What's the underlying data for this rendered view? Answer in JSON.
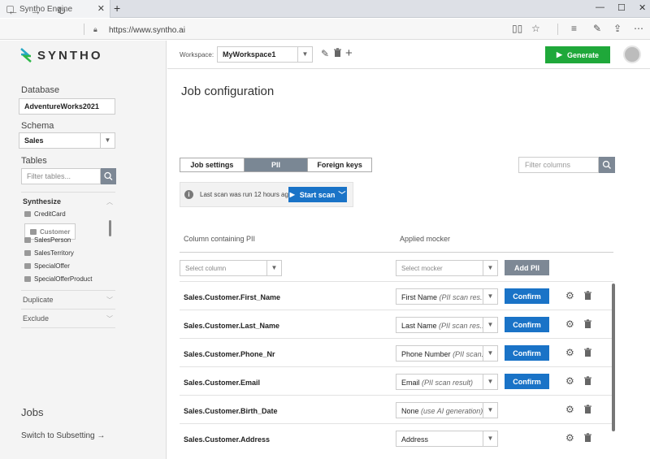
{
  "browser": {
    "tab_title": "Syntho Engine",
    "url": "https://www.syntho.ai"
  },
  "sidebar": {
    "logo": "SYNTHO",
    "database_label": "Database",
    "database_value": "AdventureWorks2021",
    "schema_label": "Schema",
    "schema_value": "Sales",
    "tables_label": "Tables",
    "filter_placeholder": "Filter tables...",
    "synthesize_label": "Synthesize",
    "tables": [
      "CreditCard",
      "Customer",
      "SalesPerson",
      "SalesTerritory",
      "SpecialOffer",
      "SpecialOfferProduct"
    ],
    "selected_table": "Customer",
    "duplicate_label": "Duplicate",
    "exclude_label": "Exclude",
    "jobs_label": "Jobs",
    "switch_label": "Switch to Subsetting →"
  },
  "topbar": {
    "workspace_label": "Workspace:",
    "workspace_value": "MyWorkspace1",
    "generate_label": "Generate"
  },
  "main": {
    "title": "Job configuration",
    "tabs": [
      "Job settings",
      "PII",
      "Foreign keys"
    ],
    "active_tab": "PII",
    "filter_columns_placeholder": "Filter columns",
    "scan_info": "Last scan was run 12 hours ago.",
    "start_scan_label": "Start scan",
    "col_header_pii": "Column containing PII",
    "col_header_mocker": "Applied mocker",
    "select_column_placeholder": "Select column",
    "select_mocker_placeholder": "Select mocker",
    "add_pii_label": "Add PII",
    "confirm_label": "Confirm",
    "rows": [
      {
        "column": "Sales.Customer.First_Name",
        "mocker": "First Name",
        "hint": "(PII scan res...",
        "confirm": true
      },
      {
        "column": "Sales.Customer.Last_Name",
        "mocker": "Last Name",
        "hint": "(PII scan res...",
        "confirm": true
      },
      {
        "column": "Sales.Customer.Phone_Nr",
        "mocker": "Phone Number",
        "hint": "(PII scan...",
        "confirm": true
      },
      {
        "column": "Sales.Customer.Email",
        "mocker": "Email",
        "hint": "(PII scan result)",
        "confirm": true
      },
      {
        "column": "Sales.Customer.Birth_Date",
        "mocker": "None",
        "hint": "(use AI generation)",
        "confirm": false
      },
      {
        "column": "Sales.Customer.Address",
        "mocker": "Address",
        "hint": "",
        "confirm": false
      }
    ]
  },
  "colors": {
    "accent_blue": "#1a73c7",
    "generate_green": "#1fa83a",
    "slate": "#7d8895"
  }
}
